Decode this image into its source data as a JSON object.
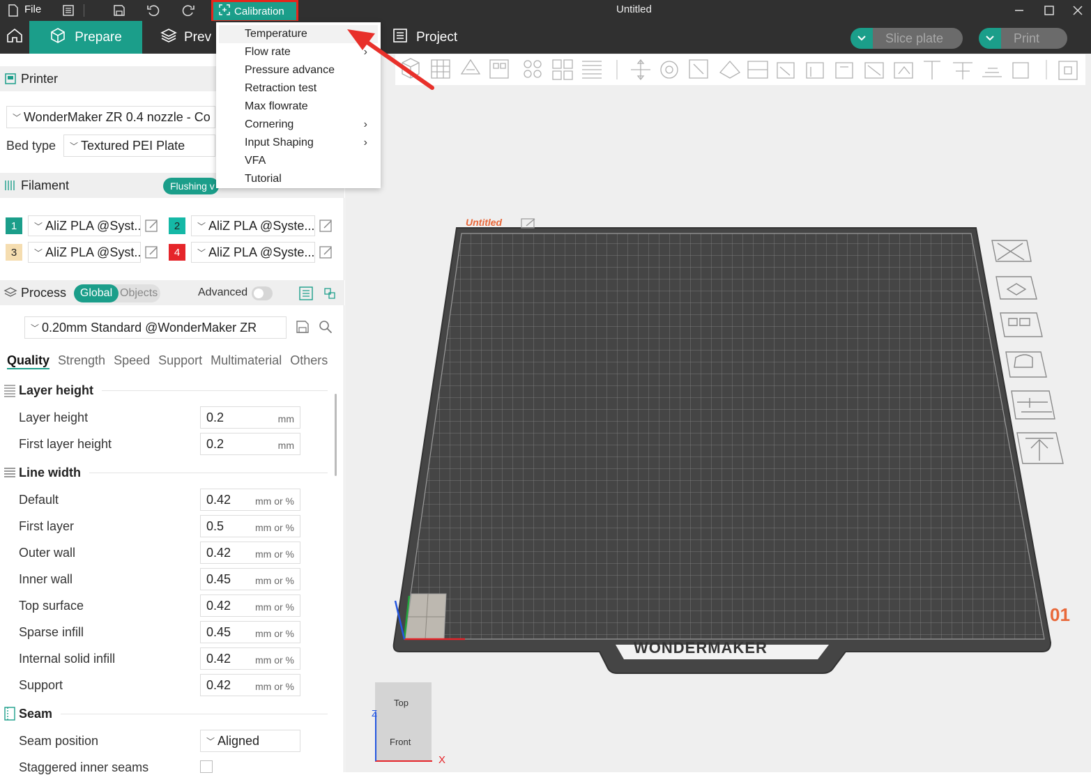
{
  "titlebar": {
    "file_label": "File",
    "calibration_label": "Calibration",
    "window_title": "Untitled"
  },
  "toolbar": {
    "prepare_label": "Prepare",
    "preview_label": "Prev",
    "project_label": "Project",
    "slice_label": "Slice plate",
    "print_label": "Print"
  },
  "calibration_menu": {
    "items": [
      {
        "label": "Temperature",
        "submenu": false
      },
      {
        "label": "Flow rate",
        "submenu": true
      },
      {
        "label": "Pressure advance",
        "submenu": false
      },
      {
        "label": "Retraction test",
        "submenu": false
      },
      {
        "label": "Max flowrate",
        "submenu": false
      },
      {
        "label": "Cornering",
        "submenu": true
      },
      {
        "label": "Input Shaping",
        "submenu": true
      },
      {
        "label": "VFA",
        "submenu": false
      },
      {
        "label": "Tutorial",
        "submenu": false
      }
    ]
  },
  "printer": {
    "heading": "Printer",
    "selected": "WonderMaker ZR 0.4 nozzle - Co",
    "bed_type_label": "Bed type",
    "bed_type_value": "Textured PEI Plate"
  },
  "filament": {
    "heading": "Filament",
    "flushing_label": "Flushing v",
    "slots": [
      {
        "num": "1",
        "name": "AliZ PLA @Syst...",
        "color": "#1b9e8a",
        "text_color": "#ffffff"
      },
      {
        "num": "2",
        "name": "AliZ PLA @Syste...",
        "color": "#15b8a6",
        "text_color": "#222222"
      },
      {
        "num": "3",
        "name": "AliZ PLA @Syst...",
        "color": "#f5ddb0",
        "text_color": "#222222"
      },
      {
        "num": "4",
        "name": "AliZ PLA @Syste...",
        "color": "#e5252a",
        "text_color": "#ffffff"
      }
    ]
  },
  "process": {
    "heading": "Process",
    "global_label": "Global",
    "objects_label": "Objects",
    "advanced_label": "Advanced",
    "profile": "0.20mm Standard @WonderMaker ZR",
    "tabs": [
      "Quality",
      "Strength",
      "Speed",
      "Support",
      "Multimaterial",
      "Others"
    ],
    "groups": {
      "layer_height": {
        "title": "Layer height",
        "rows": [
          {
            "label": "Layer height",
            "value": "0.2",
            "unit": "mm"
          },
          {
            "label": "First layer height",
            "value": "0.2",
            "unit": "mm"
          }
        ]
      },
      "line_width": {
        "title": "Line width",
        "rows": [
          {
            "label": "Default",
            "value": "0.42",
            "unit": "mm or %"
          },
          {
            "label": "First layer",
            "value": "0.5",
            "unit": "mm or %"
          },
          {
            "label": "Outer wall",
            "value": "0.42",
            "unit": "mm or %"
          },
          {
            "label": "Inner wall",
            "value": "0.45",
            "unit": "mm or %"
          },
          {
            "label": "Top surface",
            "value": "0.42",
            "unit": "mm or %"
          },
          {
            "label": "Sparse infill",
            "value": "0.45",
            "unit": "mm or %"
          },
          {
            "label": "Internal solid infill",
            "value": "0.42",
            "unit": "mm or %"
          },
          {
            "label": "Support",
            "value": "0.42",
            "unit": "mm or %"
          }
        ]
      },
      "seam": {
        "title": "Seam",
        "seam_position_label": "Seam position",
        "seam_position_value": "Aligned",
        "staggered_label": "Staggered inner seams"
      }
    }
  },
  "viewport": {
    "plate_name": "Untitled",
    "plate_number": "01",
    "bed_brand": "WONDERMAKER",
    "cube_top": "Top",
    "cube_front": "Front",
    "axis_x": "X",
    "axis_z": "Z",
    "accent_color": "#1b9e8a",
    "plate_num_color": "#e8683a"
  }
}
